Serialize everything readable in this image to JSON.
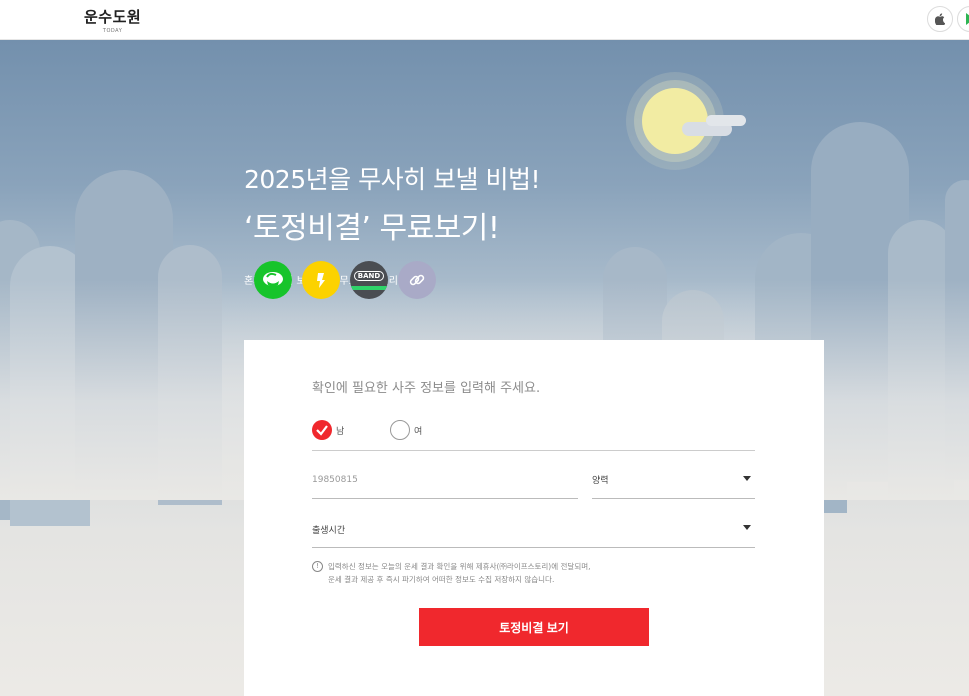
{
  "header": {
    "logo_main": "운수도원",
    "logo_sub": "TODAY"
  },
  "hero": {
    "headline_line1": "2025년을 무사히 보낼 비법!",
    "headline_line2": "‘토정비결’ 무료보기!",
    "share_note": "혼자만 아껴 보지 말고 무료니까 널리널리~",
    "share_buttons": [
      {
        "name": "kakaotalk",
        "color": "#17c42b"
      },
      {
        "name": "kakaostory",
        "color": "#fcd200"
      },
      {
        "name": "band",
        "label": "BAND",
        "color": "#4a4d52"
      },
      {
        "name": "link",
        "color": "#a9aac7"
      }
    ]
  },
  "form": {
    "intro": "확인에 필요한 사주 정보를 입력해 주세요.",
    "gender_male": "남",
    "gender_female": "여",
    "birthdate_placeholder": "19850815",
    "calendar_type": "양력",
    "birth_time": "출생시간",
    "notice_line1": "입력하신 정보는 오늘의 운세 결과 확인을 위해 제휴사(㈜라이프스토리)에 전달되며,",
    "notice_line2": "운세 결과 제공 후 즉시 파기하여 어떠한 정보도 수집 저장하지 않습니다.",
    "submit_label": "토정비결 보기",
    "accent_color": "#f0282d"
  }
}
